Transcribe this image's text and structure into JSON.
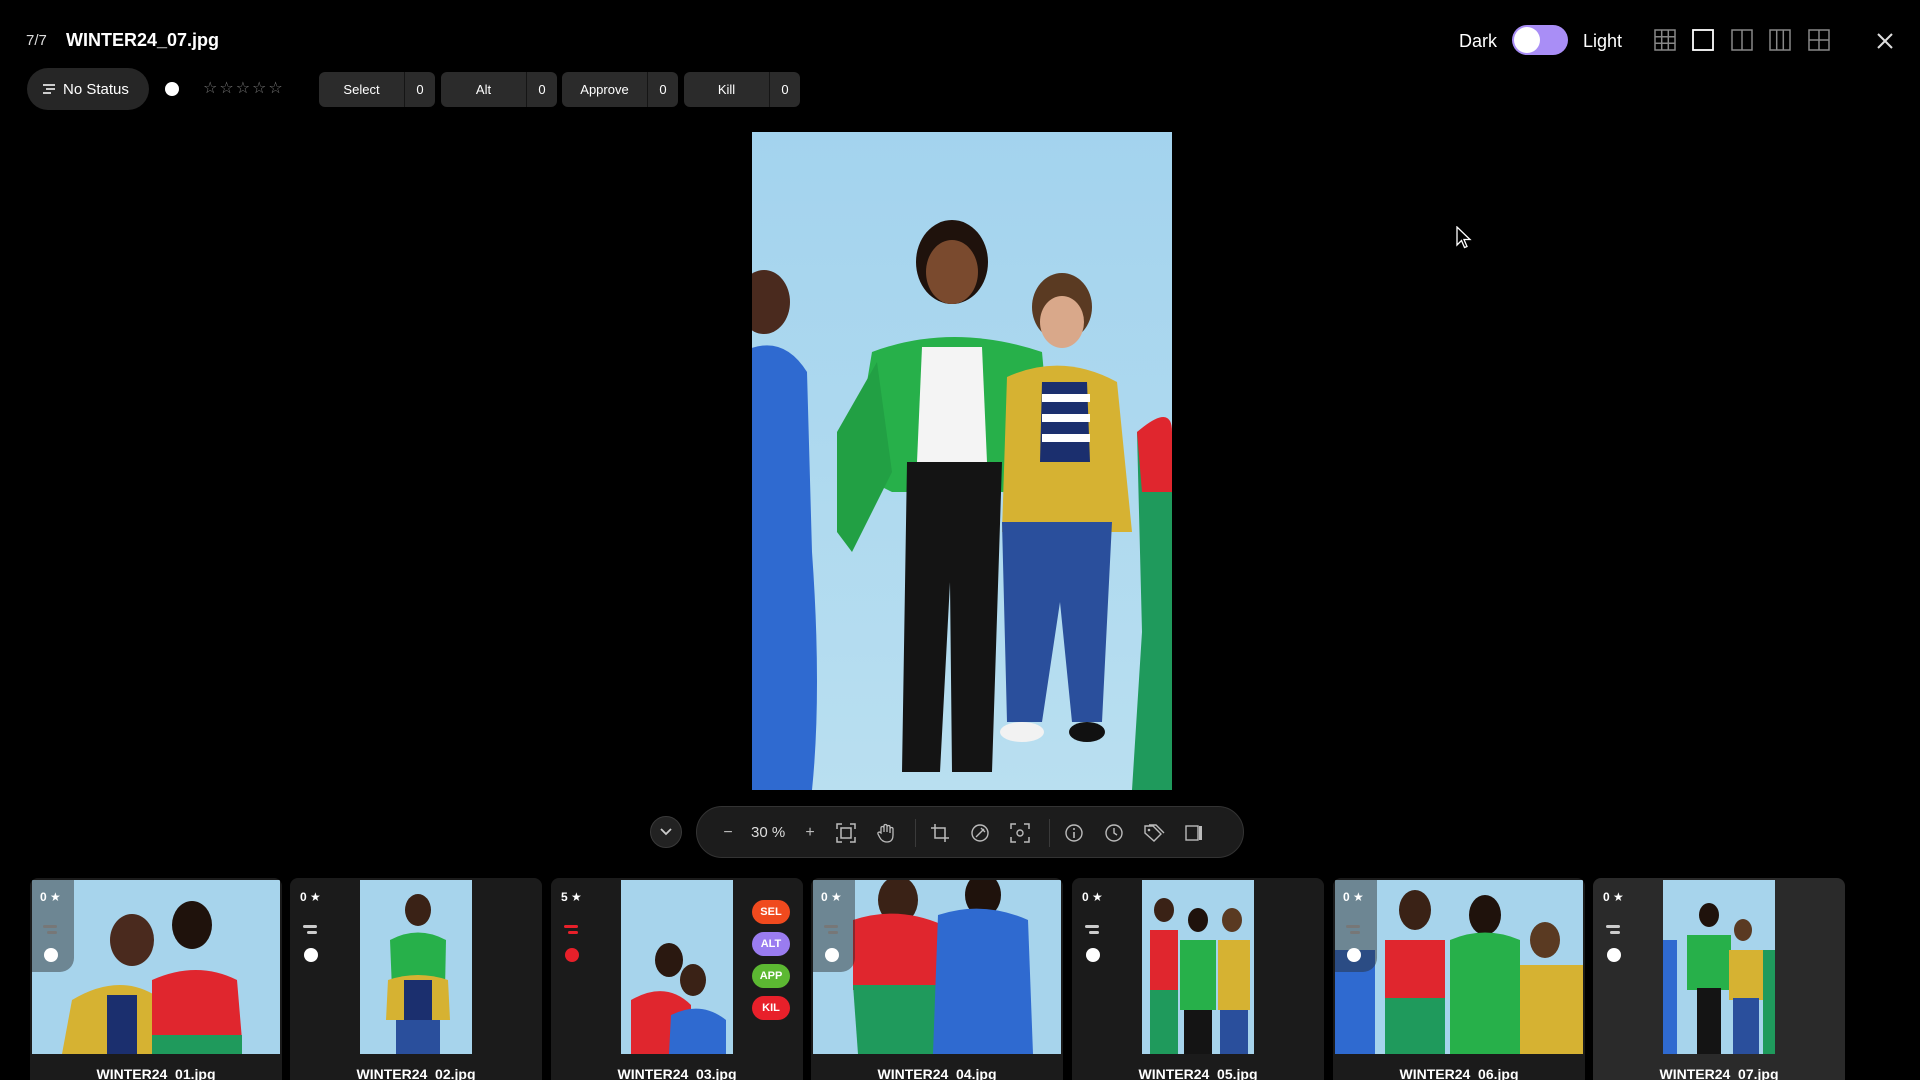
{
  "header": {
    "counter": "7/7",
    "filename": "WINTER24_07.jpg",
    "theme_dark_label": "Dark",
    "theme_light_label": "Light"
  },
  "status": {
    "label": "No Status",
    "stars": "☆☆☆☆☆"
  },
  "counters": [
    {
      "label": "Select",
      "count": "0"
    },
    {
      "label": "Alt",
      "count": "0"
    },
    {
      "label": "Approve",
      "count": "0"
    },
    {
      "label": "Kill",
      "count": "0"
    }
  ],
  "toolbar": {
    "zoom_out": "−",
    "zoom": "30 %",
    "zoom_in": "+"
  },
  "filmstrip": [
    {
      "rating": "0",
      "filename": "WINTER24_01.jpg"
    },
    {
      "rating": "0",
      "filename": "WINTER24_02.jpg"
    },
    {
      "rating": "5",
      "filename": "WINTER24_03.jpg",
      "tags": [
        "SEL",
        "ALT",
        "APP",
        "KIL"
      ]
    },
    {
      "rating": "0",
      "filename": "WINTER24_04.jpg"
    },
    {
      "rating": "0",
      "filename": "WINTER24_05.jpg"
    },
    {
      "rating": "0",
      "filename": "WINTER24_06.jpg"
    },
    {
      "rating": "0",
      "filename": "WINTER24_07.jpg"
    }
  ],
  "colors": {
    "accent": "#a98ef6",
    "sky": "#9fd0ec",
    "tag_sel": "#f04a1e",
    "tag_alt": "#9a7cf0",
    "tag_app": "#5cb832",
    "tag_kil": "#e8202a"
  }
}
